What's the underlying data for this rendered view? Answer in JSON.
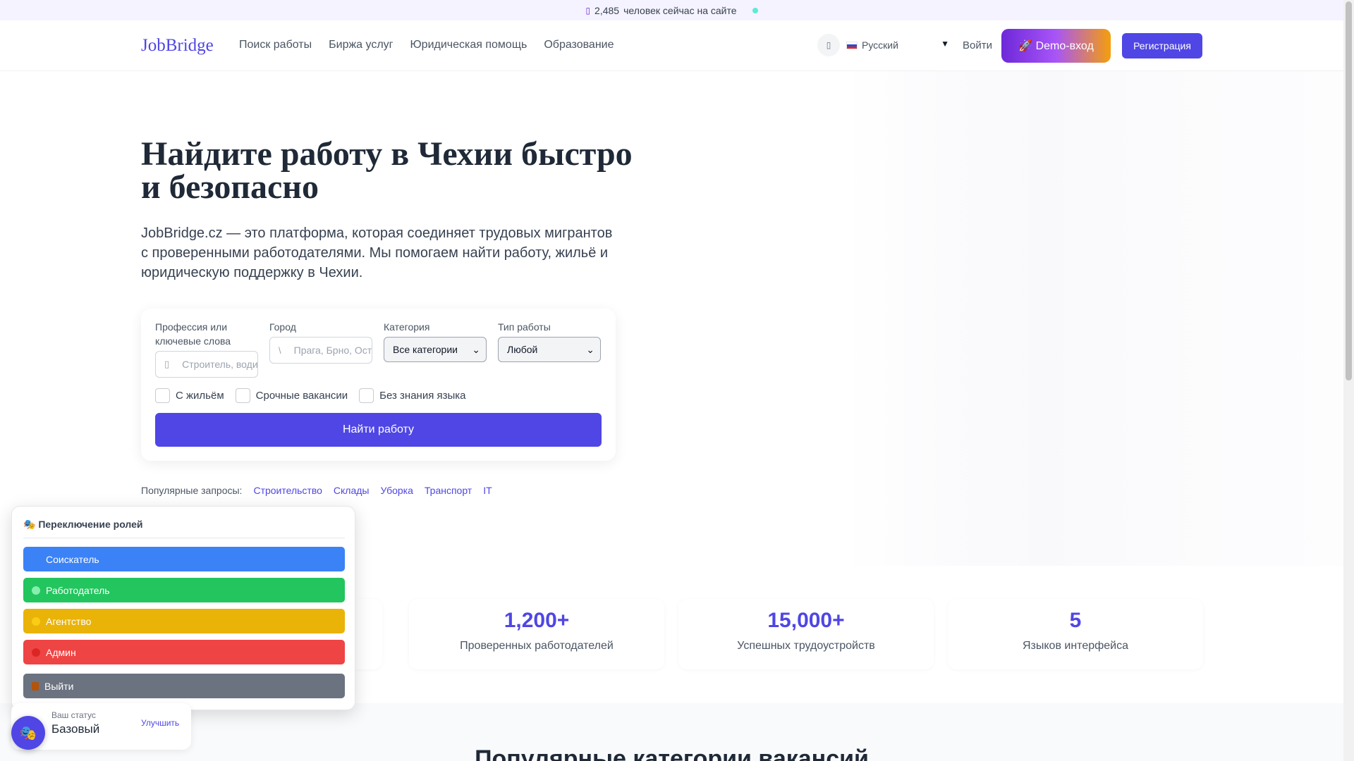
{
  "topbar": {
    "icon": "pulse-icon",
    "count": "2,485",
    "text": "человек сейчас на сайте",
    "dot_color": "#5eead4"
  },
  "header": {
    "logo": "JobBridge",
    "nav": [
      "Поиск работы",
      "Биржа услуг",
      "Юридическая помощь",
      "Образование"
    ],
    "theme_icon": "moon-icon",
    "language": "Русский",
    "login": "Войти",
    "demo": "🚀 Demo-вход",
    "register": "Регистрация"
  },
  "hero": {
    "title": "Найдите работу в Чехии быстро и безопасно",
    "subtitle": "JobBridge.cz — это платформа, которая соединяет трудовых мигрантов с проверенными работодателями. Мы помогаем найти работу, жильё и юридическую поддержку в Чехии."
  },
  "search": {
    "keywords_label": "Профессия или ключевые слова",
    "keywords_placeholder": "Строитель, водитель...",
    "city_label": "Город",
    "city_placeholder": "Прага, Брно, Остра...",
    "category_label": "Категория",
    "category_value": "Все категории",
    "type_label": "Тип работы",
    "type_value": "Любой",
    "checks": [
      "С жильём",
      "Срочные вакансии",
      "Без знания языка"
    ],
    "button": "Найти работу"
  },
  "popular": {
    "label": "Популярные запросы:",
    "items": [
      "Строительство",
      "Склады",
      "Уборка",
      "Транспорт",
      "IT"
    ]
  },
  "stats": [
    {
      "num": "1,200+",
      "label": "Проверенных работодателей"
    },
    {
      "num": "15,000+",
      "label": "Успешных трудоустройств"
    },
    {
      "num": "5",
      "label": "Языков интерфейса"
    }
  ],
  "section": {
    "title": "Популярные категории вакансий"
  },
  "roles": {
    "title": "🎭 Переключение ролей",
    "items": [
      {
        "label": "Соискатель",
        "color": "#3b82f6",
        "dot": "#3b82f6"
      },
      {
        "label": "Работодатель",
        "color": "#22c55e",
        "dot": "#86efac"
      },
      {
        "label": "Агентство",
        "color": "#eab308",
        "dot": "#facc15"
      },
      {
        "label": "Админ",
        "color": "#ef4444",
        "dot": "#dc2626"
      }
    ],
    "logout": "Выйти",
    "logout_color": "#6b7280"
  },
  "status": {
    "label": "Ваш статус",
    "value": "Базовый",
    "upgrade": "Улучшить"
  }
}
